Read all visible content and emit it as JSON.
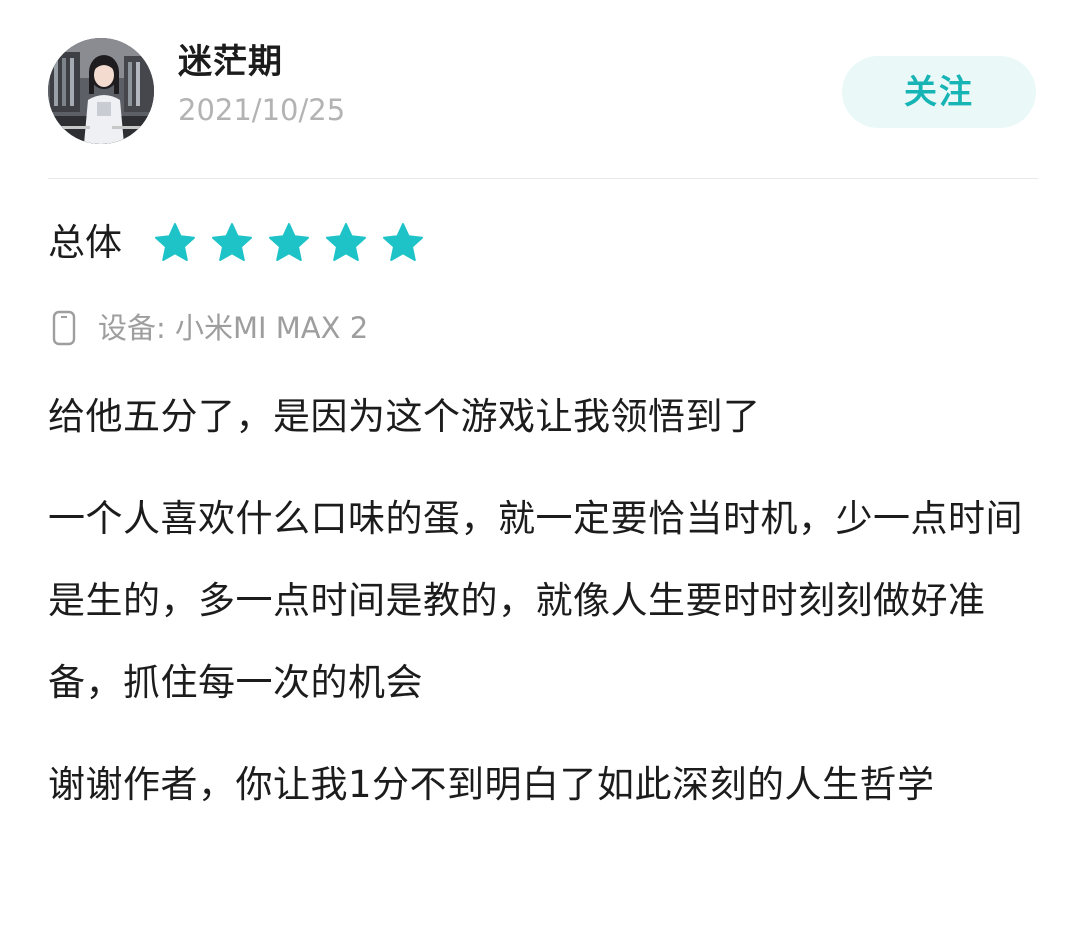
{
  "user": {
    "name": "迷茫期",
    "date": "2021/10/25",
    "avatar_icon": "anime-girl-avatar"
  },
  "follow_button": {
    "label": "关注",
    "color": "#16b4b4",
    "background": "#eaf8f8"
  },
  "rating": {
    "label": "总体",
    "stars": 5,
    "max_stars": 5,
    "star_color": "#1ec3c8",
    "star_icon": "star-icon"
  },
  "device": {
    "icon": "phone-icon",
    "text": "设备: 小米MI MAX 2"
  },
  "review": {
    "paragraphs": [
      "给他五分了，是因为这个游戏让我领悟到了",
      "一个人喜欢什么口味的蛋，就一定要恰当时机，少一点时间是生的，多一点时间是教的，就像人生要时时刻刻做好准备，抓住每一次的机会",
      "谢谢作者，你让我1分不到明白了如此深刻的人生哲学"
    ]
  }
}
